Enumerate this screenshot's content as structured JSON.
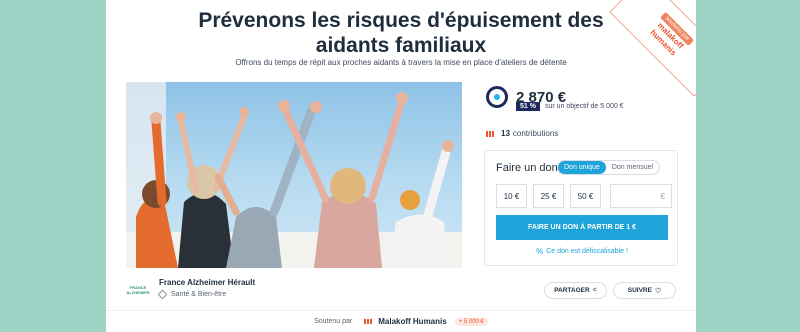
{
  "campaign": {
    "title_line1": "Prévenons les risques d'épuisement des",
    "title_line2": "aidants familiaux",
    "subtitle": "Offrons du temps de répit aux proches aidants à travers la mise en place d'ateliers de détente"
  },
  "ribbon": {
    "label": "soutenu par",
    "brand_line1": "malakoff",
    "brand_line2": "humanis"
  },
  "funding": {
    "amount": "2 870 €",
    "percent_label": "51 %",
    "percent": 0.51,
    "objective": "sur un objectif de 5 000 €",
    "contributions_count": "13",
    "contributions_label": "contributions"
  },
  "donation": {
    "heading": "Faire un don",
    "tab_single": "Don unique",
    "tab_monthly": "Don mensuel",
    "amounts": [
      "10 €",
      "25 €",
      "50 €"
    ],
    "custom_suffix": "€",
    "cta": "FAIRE UN DON À PARTIR DE 1 €",
    "tax_icon": "%",
    "tax_note": "Ce don est défiscalisable !"
  },
  "organization": {
    "logo_line1": "FRANCE",
    "logo_line2": "ALZHEIMER",
    "name": "France Alzheimer Hérault",
    "category": "Santé & Bien-être"
  },
  "actions": {
    "share": "PARTAGER",
    "share_icon": "<",
    "follow": "SUIVRE",
    "follow_icon": "♡"
  },
  "footer": {
    "supported_by": "Soutenu par",
    "sponsor": "Malakoff Humanis",
    "sponsor_amount": "+ 5 000 €"
  },
  "colors": {
    "background": "#9fd3c6",
    "primary": "#1ea4d8",
    "navy": "#1e2a5e",
    "brand_orange": "#e8572e"
  },
  "icons": [
    "progress-ring-icon",
    "contributions-icon",
    "percent-icon",
    "tag-icon",
    "share-icon",
    "heart-icon"
  ]
}
